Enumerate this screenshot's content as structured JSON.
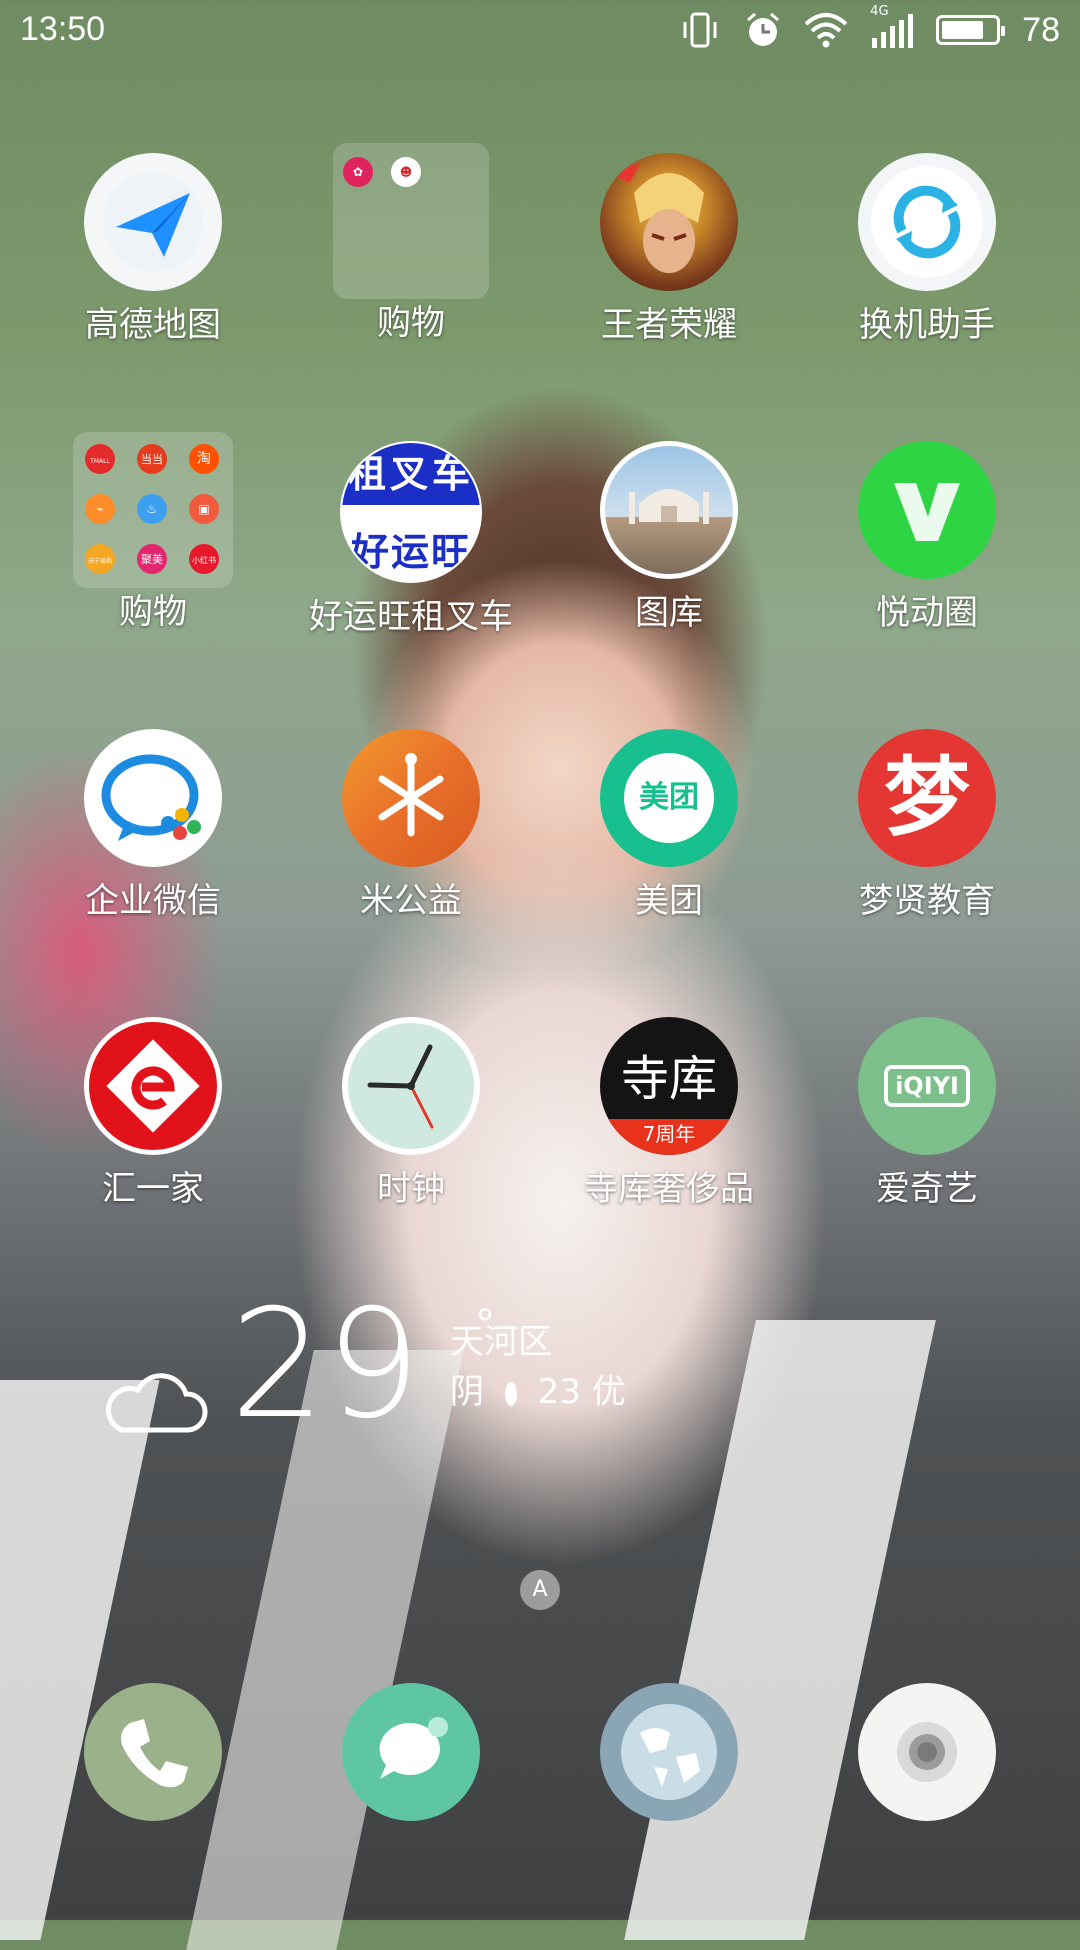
{
  "status": {
    "time": "13:50",
    "battery_level": "78",
    "battery_fraction": 0.78,
    "network": "4G",
    "icons": [
      "vibrate-icon",
      "alarm-icon",
      "wifi-icon",
      "signal-icon",
      "battery-icon"
    ]
  },
  "apps": [
    {
      "label": "高德地图",
      "icon": "paper-plane-icon"
    },
    {
      "label": "购物",
      "icon": "folder-icon"
    },
    {
      "label": "王者荣耀",
      "icon": "hero-portrait-icon"
    },
    {
      "label": "换机助手",
      "icon": "sync-arrows-icon"
    },
    {
      "label": "购物",
      "icon": "folder-icon"
    },
    {
      "label": "好运旺租叉车",
      "icon": "forklift-rental-icon",
      "icon_text_top": "租叉车",
      "icon_text_bottom": "好运旺"
    },
    {
      "label": "图库",
      "icon": "gallery-icon"
    },
    {
      "label": "悦动圈",
      "icon": "fitness-icon"
    },
    {
      "label": "企业微信",
      "icon": "chat-bubble-icon"
    },
    {
      "label": "米公益",
      "icon": "wheat-icon"
    },
    {
      "label": "美团",
      "icon": "meituan-icon",
      "icon_text": "美团"
    },
    {
      "label": "梦贤教育",
      "icon": "calligraphy-icon",
      "icon_text": "梦"
    },
    {
      "label": "汇一家",
      "icon": "e-logo-icon"
    },
    {
      "label": "时钟",
      "icon": "clock-icon"
    },
    {
      "label": "寺库奢侈品",
      "icon": "secoo-icon",
      "icon_text": "寺库",
      "icon_subtext": "7周年"
    },
    {
      "label": "爱奇艺",
      "icon": "iqiyi-icon",
      "icon_text": "iQIYI"
    }
  ],
  "folder_small_labels": {
    "tmall": "TMALL",
    "dangdang": "当当",
    "taobao": "淘",
    "suning": "苏宁易购",
    "jumei": "聚美",
    "xiaohongshu": "小红书"
  },
  "weather": {
    "temperature": "29",
    "degree": "°",
    "location": "天河区",
    "condition": "阴",
    "aqi": "23 优"
  },
  "page_indicator": "A",
  "dock": [
    {
      "icon": "phone-icon"
    },
    {
      "icon": "messages-icon"
    },
    {
      "icon": "browser-globe-icon"
    },
    {
      "icon": "camera-icon"
    }
  ],
  "colors": {
    "amap_blue": "#1e90ff",
    "meituan_green": "#17c08e",
    "yuedong_green": "#2fd445",
    "iqiyi_green": "#7dbf8b",
    "dock_phone": "#9ab18c",
    "dock_msg": "#5fc6a4",
    "dock_browser": "#8aa6b4"
  }
}
